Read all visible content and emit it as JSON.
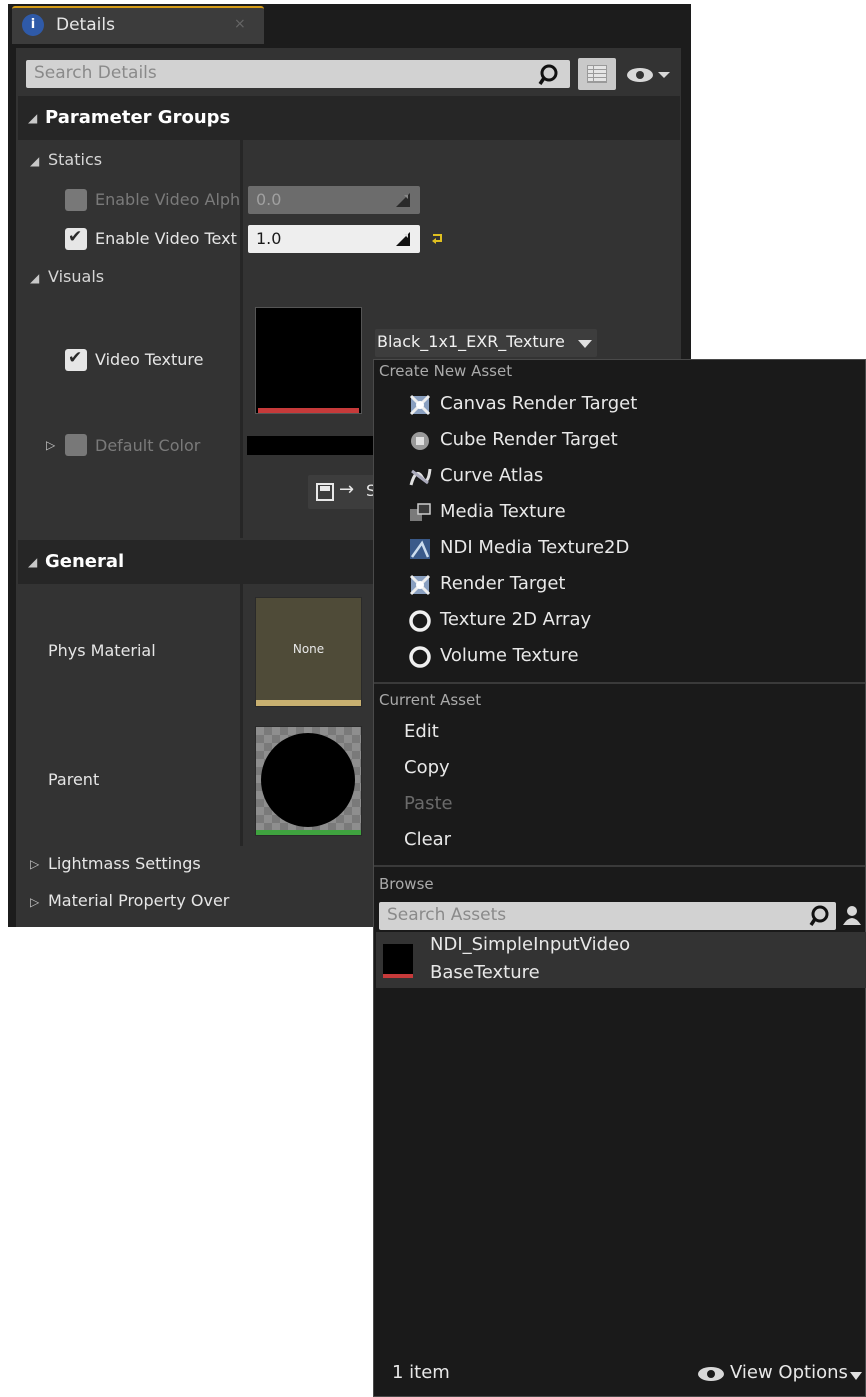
{
  "tab": {
    "title": "Details",
    "icon": "details-info-icon",
    "close": "×"
  },
  "search": {
    "placeholder": "Search Details"
  },
  "groups": {
    "parameter_groups": "Parameter Groups",
    "statics": "Statics",
    "visuals": "Visuals",
    "general": "General",
    "lightmass": "Lightmass Settings",
    "material_property": "Material Property Over"
  },
  "statics": {
    "enable_video_alpha": {
      "label": "Enable Video Alph",
      "value": "0.0",
      "checked": false,
      "enabled": false
    },
    "enable_video_texture": {
      "label": "Enable Video Text",
      "value": "1.0",
      "checked": true,
      "enabled": true
    }
  },
  "visuals": {
    "video_texture": {
      "label": "Video Texture",
      "checked": true,
      "asset": "Black_1x1_EXR_Texture"
    },
    "default_color": {
      "label": "Default Color",
      "checked": false
    },
    "save_button": "↦",
    "save_glyph": "S"
  },
  "general": {
    "phys_material": {
      "label": "Phys Material",
      "thumb_text": "None"
    },
    "parent": {
      "label": "Parent"
    }
  },
  "menu": {
    "create_new_asset": "Create New Asset",
    "create_items": [
      {
        "label": "Canvas Render Target",
        "icon": "canvas-render-target-icon"
      },
      {
        "label": "Cube Render Target",
        "icon": "cube-render-target-icon"
      },
      {
        "label": "Curve Atlas",
        "icon": "curve-atlas-icon"
      },
      {
        "label": "Media Texture",
        "icon": "media-texture-icon"
      },
      {
        "label": "NDI Media Texture2D",
        "icon": "ndi-media-texture-icon"
      },
      {
        "label": "Render Target",
        "icon": "render-target-icon"
      },
      {
        "label": "Texture 2D Array",
        "icon": "texture-2d-array-icon"
      },
      {
        "label": "Volume Texture",
        "icon": "volume-texture-icon"
      }
    ],
    "current_asset": "Current Asset",
    "current_items": [
      {
        "label": "Edit",
        "enabled": true
      },
      {
        "label": "Copy",
        "enabled": true
      },
      {
        "label": "Paste",
        "enabled": false
      },
      {
        "label": "Clear",
        "enabled": true
      }
    ],
    "browse": "Browse",
    "search_assets_placeholder": "Search Assets",
    "asset_name_line1": "NDI_SimpleInputVideo",
    "asset_name_line2": "BaseTexture",
    "item_count": "1 item",
    "view_options": "View Options"
  },
  "colors": {
    "panel_bg": "#333333",
    "menu_bg": "#1a1a1a",
    "accent_orange": "#d59c17",
    "texture_red": "#c63a3a",
    "material_yellow": "#c8b070",
    "parent_green": "#3fa33f",
    "reset_yellow": "#e0c020"
  }
}
